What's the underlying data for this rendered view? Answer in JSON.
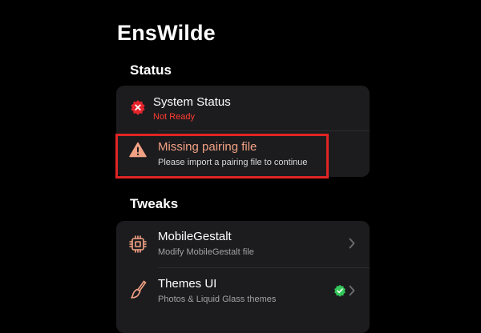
{
  "app": {
    "title": "EnsWilde"
  },
  "status_section": {
    "title": "Status",
    "system_status": {
      "title": "System Status",
      "value": "Not Ready",
      "icon": "error-badge-icon",
      "value_color": "#ff3b30"
    },
    "warning": {
      "title": "Missing pairing file",
      "subtitle": "Please import a pairing file to continue",
      "icon": "warning-triangle-icon",
      "accent_color": "#f2a184"
    }
  },
  "tweaks_section": {
    "title": "Tweaks",
    "items": [
      {
        "title": "MobileGestalt",
        "subtitle": "Modify MobileGestalt file",
        "icon": "cpu-chip-icon",
        "trailing": "chevron-right-icon"
      },
      {
        "title": "Themes UI",
        "subtitle": "Photos & Liquid Glass themes",
        "icon": "paintbrush-icon",
        "badge_icon": "verified-check-icon",
        "trailing": "chevron-right-icon"
      }
    ]
  },
  "colors": {
    "background": "#000000",
    "card": "#1c1c1e",
    "icon_accent": "#f2a184",
    "highlight_border": "#e02424",
    "verified": "#34c759"
  }
}
